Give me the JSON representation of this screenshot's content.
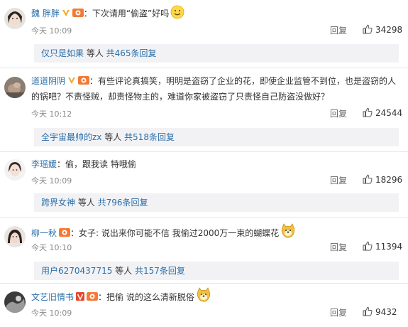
{
  "comments": [
    {
      "username": "魏 胖胖",
      "text_prefix": "：下次请用“偷盗”好吗",
      "time": "今天 10:09",
      "reply_label": "回复",
      "likes": "34298",
      "subreply": {
        "user": "仅只是如果",
        "mid": " 等人 ",
        "count": "共465条回复"
      }
    },
    {
      "username": "道道阴阴",
      "text_prefix": "：有些评论真搞笑，明明是盗窃了企业的花，即使企业监管不到位，也是盗窃的人的锅吧？不责怪贼，却责怪物主的，难道你家被盗窃了只责怪自己防盗没做好？",
      "time": "今天 10:12",
      "reply_label": "回复",
      "likes": "24544",
      "subreply": {
        "user": "全宇宙最帅的zx",
        "mid": " 等人 ",
        "count": "共518条回复"
      }
    },
    {
      "username": "李瑶媛",
      "text_prefix": "：偷，跟我读 特哦偷",
      "time": "今天 10:09",
      "reply_label": "回复",
      "likes": "18296",
      "subreply": {
        "user": "跨界女神",
        "mid": " 等人 ",
        "count": "共796条回复"
      }
    },
    {
      "username": "柳一秋",
      "text_prefix": "：女子: 说出来你可能不信 我偷过2000万一束的蝴蝶花",
      "time": "今天 10:10",
      "reply_label": "回复",
      "likes": "11394",
      "subreply": {
        "user": "用户6270437715",
        "mid": " 等人 ",
        "count": "共157条回复"
      }
    },
    {
      "username": "文艺旧情书",
      "text_prefix": "：把偷  说的这么清新脱俗",
      "time": "今天 10:09",
      "reply_label": "回复",
      "likes": "9432"
    }
  ],
  "colors": {
    "link": "#2b6ea8",
    "vip_badge": "#f27a38",
    "verified_badge": "#f5a623",
    "time": "#8a8a8a",
    "subreply_bg": "#f2f2f5"
  },
  "icons": {
    "like": "thumbs-up-icon",
    "smile": "smile-emoji-icon",
    "doge": "doge-emoji-icon"
  }
}
